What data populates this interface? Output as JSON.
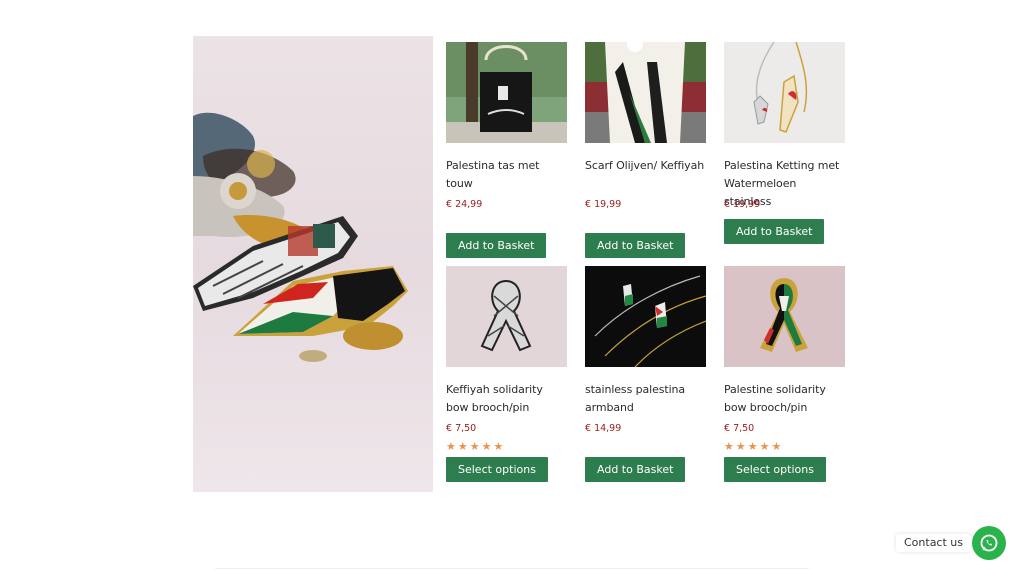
{
  "products": [
    {
      "title": "Palestina tas met touw",
      "price": "€ 24,99",
      "button": "Add to Basket",
      "rating": ""
    },
    {
      "title": "Scarf Olijven/ Keffiyah",
      "price": "€ 19,99",
      "button": "Add to Basket",
      "rating": ""
    },
    {
      "title": "Palestina Ketting met Watermeloen stainless",
      "price": "€ 19,99",
      "button": "Add to Basket",
      "rating": ""
    },
    {
      "title": "Keffiyah solidarity bow brooch/pin",
      "price": "€ 7,50",
      "button": "Select options",
      "rating": "★★★★★"
    },
    {
      "title": "stainless palestina armband",
      "price": "€ 14,99",
      "button": "Add to Basket",
      "rating": ""
    },
    {
      "title": "Palestine solidarity bow brooch/pin",
      "price": "€ 7,50",
      "button": "Select options",
      "rating": "★★★★★"
    }
  ],
  "contact": {
    "label": "Contact us"
  },
  "colors": {
    "button": "#2e7d4f",
    "price": "#9b1b1b",
    "stars": "#e8944e",
    "whatsapp": "#2bb34b"
  }
}
